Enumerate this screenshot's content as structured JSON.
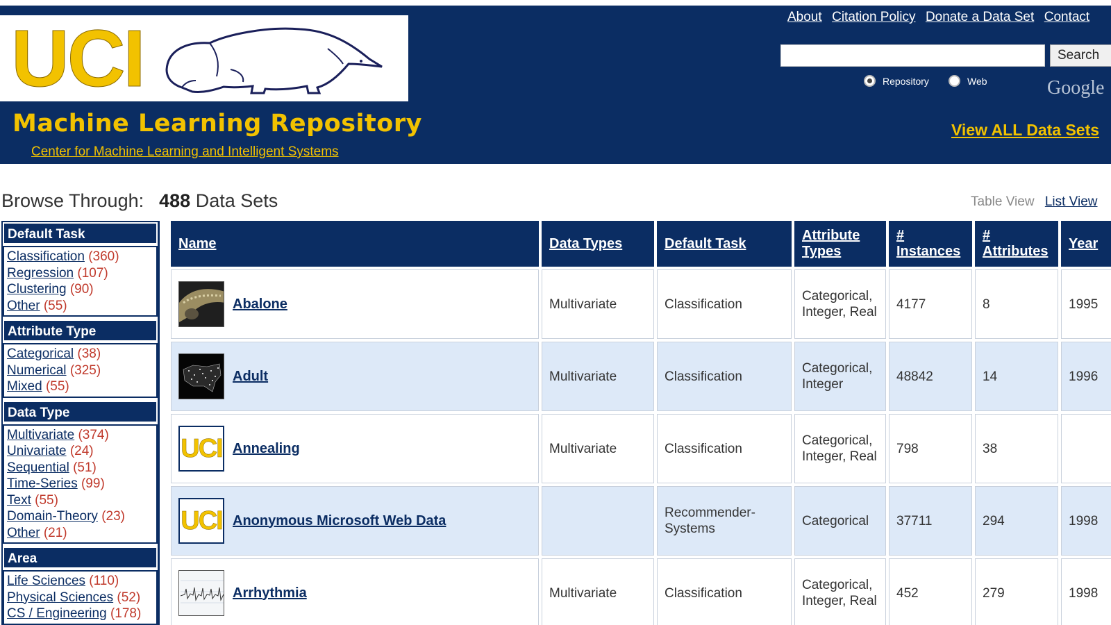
{
  "header": {
    "logo_text": "UCI",
    "title": "Machine Learning Repository",
    "subtitle": "Center for Machine Learning and Intelligent Systems",
    "top_links": [
      "About",
      "Citation Policy",
      "Donate a Data Set",
      "Contact"
    ],
    "search_button": "Search",
    "search_value": "",
    "radio_repository": "Repository",
    "radio_web": "Web",
    "radio_selected": "Repository",
    "google_label": "Google",
    "view_all": "View ALL Data Sets"
  },
  "browse": {
    "label": "Browse Through:",
    "count": "488",
    "count_suffix": "Data Sets",
    "table_view": "Table View",
    "list_view": "List View"
  },
  "sidebar": {
    "sections": [
      {
        "heading": "Default Task",
        "items": [
          {
            "label": "Classification",
            "count": "(360)"
          },
          {
            "label": "Regression",
            "count": "(107)"
          },
          {
            "label": "Clustering",
            "count": "(90)"
          },
          {
            "label": "Other",
            "count": "(55)"
          }
        ]
      },
      {
        "heading": "Attribute Type",
        "items": [
          {
            "label": "Categorical",
            "count": "(38)"
          },
          {
            "label": "Numerical",
            "count": "(325)"
          },
          {
            "label": "Mixed",
            "count": "(55)"
          }
        ]
      },
      {
        "heading": "Data Type",
        "items": [
          {
            "label": "Multivariate",
            "count": "(374)"
          },
          {
            "label": "Univariate",
            "count": "(24)"
          },
          {
            "label": "Sequential",
            "count": "(51)"
          },
          {
            "label": "Time-Series",
            "count": "(99)"
          },
          {
            "label": "Text",
            "count": "(55)"
          },
          {
            "label": "Domain-Theory",
            "count": "(23)"
          },
          {
            "label": "Other",
            "count": "(21)"
          }
        ]
      },
      {
        "heading": "Area",
        "items": [
          {
            "label": "Life Sciences",
            "count": "(110)"
          },
          {
            "label": "Physical Sciences",
            "count": "(52)"
          },
          {
            "label": "CS / Engineering",
            "count": "(178)"
          }
        ]
      }
    ]
  },
  "table": {
    "columns": [
      "Name",
      "Data Types",
      "Default Task",
      "Attribute Types",
      "# Instances",
      "# Attributes",
      "Year"
    ],
    "rows": [
      {
        "name": "Abalone",
        "thumb": "abalone-photo",
        "data_types": "Multivariate",
        "task": "Classification",
        "attr_types": "Categorical, Integer, Real",
        "instances": "4177",
        "attributes": "8",
        "year": "1995"
      },
      {
        "name": "Adult",
        "thumb": "usa-map-photo",
        "data_types": "Multivariate",
        "task": "Classification",
        "attr_types": "Categorical, Integer",
        "instances": "48842",
        "attributes": "14",
        "year": "1996"
      },
      {
        "name": "Annealing",
        "thumb": "uci-logo",
        "data_types": "Multivariate",
        "task": "Classification",
        "attr_types": "Categorical, Integer, Real",
        "instances": "798",
        "attributes": "38",
        "year": ""
      },
      {
        "name": "Anonymous Microsoft Web Data",
        "thumb": "uci-logo",
        "data_types": "",
        "task": "Recommender-Systems",
        "attr_types": "Categorical",
        "instances": "37711",
        "attributes": "294",
        "year": "1998"
      },
      {
        "name": "Arrhythmia",
        "thumb": "ecg-chart",
        "data_types": "Multivariate",
        "task": "Classification",
        "attr_types": "Categorical, Integer, Real",
        "instances": "452",
        "attributes": "279",
        "year": "1998"
      }
    ]
  },
  "colors": {
    "navy": "#0b2d63",
    "gold": "#f2c200",
    "row_alt": "#dde9f8",
    "count_red": "#c0392b"
  }
}
